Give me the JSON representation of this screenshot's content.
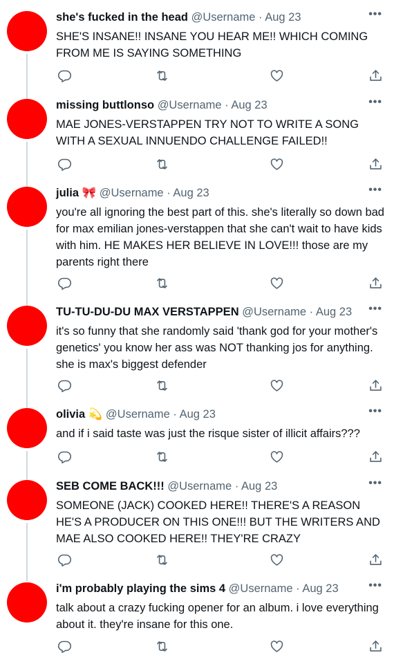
{
  "sep": "·",
  "more_glyph": "•••",
  "tweets": [
    {
      "name": "she's fucked in the head",
      "emoji": "",
      "handle": "@Username",
      "date": "Aug 23",
      "text": "SHE'S INSANE!! INSANE YOU HEAR ME!! WHICH COMING FROM ME IS SAYING SOMETHING"
    },
    {
      "name": "missing buttlonso",
      "emoji": "",
      "handle": "@Username",
      "date": "Aug 23",
      "text": "MAE JONES-VERSTAPPEN TRY NOT TO WRITE A SONG WITH A SEXUAL INNUENDO CHALLENGE FAILED!!"
    },
    {
      "name": "julia",
      "emoji": "🎀",
      "handle": "@Username",
      "date": "Aug 23",
      "text": "you're all ignoring the best part of this. she's literally so down bad for max emilian jones-verstappen that she can't wait to have kids with him. HE MAKES HER BELIEVE IN LOVE!!! those are my parents right there"
    },
    {
      "name": "TU-TU-DU-DU MAX VERSTAPPEN",
      "emoji": "",
      "handle": "@Username",
      "date": "Aug 23",
      "text": "it's so funny that she randomly said 'thank god for your mother's genetics' you know her ass was NOT thanking jos for anything. she is max's biggest defender"
    },
    {
      "name": "olivia",
      "emoji": "💫",
      "handle": "@Username",
      "date": "Aug 23",
      "text": "and if i said taste was just the risque sister of illicit affairs???"
    },
    {
      "name": "SEB COME BACK!!!",
      "emoji": "",
      "handle": "@Username",
      "date": "Aug 23",
      "text": "SOMEONE (JACK) COOKED HERE!! THERE'S A REASON HE'S A PRODUCER ON THIS ONE!!! BUT THE WRITERS AND MAE ALSO COOKED HERE!! THEY'RE CRAZY"
    },
    {
      "name": "i'm probably playing the sims 4",
      "emoji": "",
      "handle": "@Username",
      "date": "Aug 23",
      "text": "talk about a crazy fucking opener for an album. i love everything about it. they're insane for this one."
    }
  ]
}
